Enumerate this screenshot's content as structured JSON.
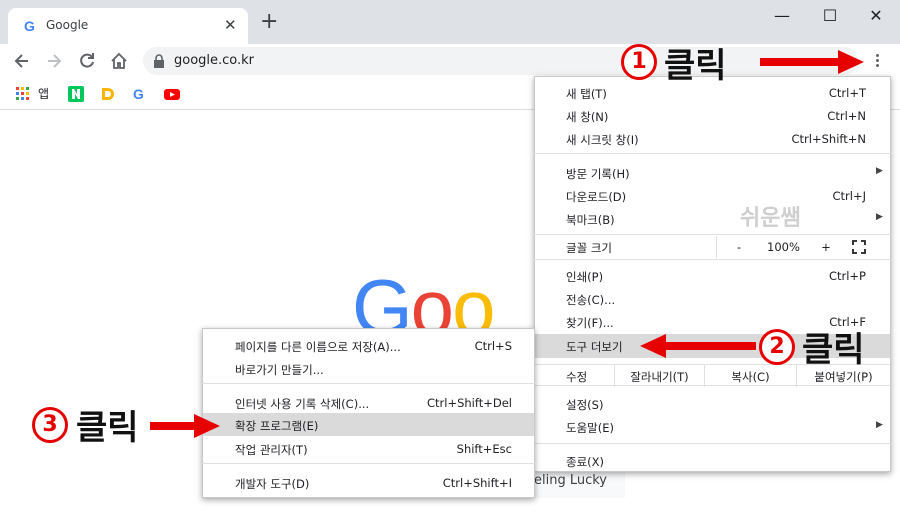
{
  "tab": {
    "title": "Google",
    "close_glyph": "✕"
  },
  "newtab_glyph": "+",
  "window": {
    "minimize": "—",
    "maximize": "☐",
    "close": "✕"
  },
  "address": {
    "url": "google.co.kr"
  },
  "bookmarks": {
    "apps_label": "앱"
  },
  "page": {
    "lucky": "eeling Lucky",
    "logo_letters": [
      "G",
      "o",
      "o"
    ]
  },
  "watermark": "쉬운쌤",
  "chrome_menu": {
    "items": [
      {
        "label": "새 탭(T)",
        "shortcut": "Ctrl+T"
      },
      {
        "label": "새 창(N)",
        "shortcut": "Ctrl+N"
      },
      {
        "label": "새 시크릿 창(I)",
        "shortcut": "Ctrl+Shift+N"
      },
      {
        "label": "방문 기록(H)",
        "shortcut": ""
      },
      {
        "label": "다운로드(D)",
        "shortcut": "Ctrl+J"
      },
      {
        "label": "북마크(B)",
        "shortcut": ""
      },
      {
        "label": "인쇄(P)",
        "shortcut": "Ctrl+P"
      },
      {
        "label": "전송(C)...",
        "shortcut": ""
      },
      {
        "label": "찾기(F)...",
        "shortcut": "Ctrl+F"
      },
      {
        "label": "도구 더보기",
        "shortcut": ""
      },
      {
        "label": "설정(S)",
        "shortcut": ""
      },
      {
        "label": "도움말(E)",
        "shortcut": ""
      },
      {
        "label": "종료(X)",
        "shortcut": ""
      }
    ],
    "zoom": {
      "label": "글꼴 크기",
      "minus": "-",
      "value": "100%",
      "plus": "+"
    },
    "edit": {
      "label": "수정",
      "cut": "잘라내기(T)",
      "copy": "복사(C)",
      "paste": "붙여넣기(P)"
    }
  },
  "tools_menu": {
    "items": [
      {
        "label": "페이지를 다른 이름으로 저장(A)...",
        "shortcut": "Ctrl+S"
      },
      {
        "label": "바로가기 만들기...",
        "shortcut": ""
      },
      {
        "label": "인터넷 사용 기록 삭제(C)...",
        "shortcut": "Ctrl+Shift+Del"
      },
      {
        "label": "확장 프로그램(E)",
        "shortcut": ""
      },
      {
        "label": "작업 관리자(T)",
        "shortcut": "Shift+Esc"
      },
      {
        "label": "개발자 도구(D)",
        "shortcut": "Ctrl+Shift+I"
      }
    ]
  },
  "annotations": {
    "step1": {
      "num": "1",
      "text": "클릭"
    },
    "step2": {
      "num": "2",
      "text": "클릭"
    },
    "step3": {
      "num": "3",
      "text": "클릭"
    },
    "arrow_color": "#e60000"
  }
}
